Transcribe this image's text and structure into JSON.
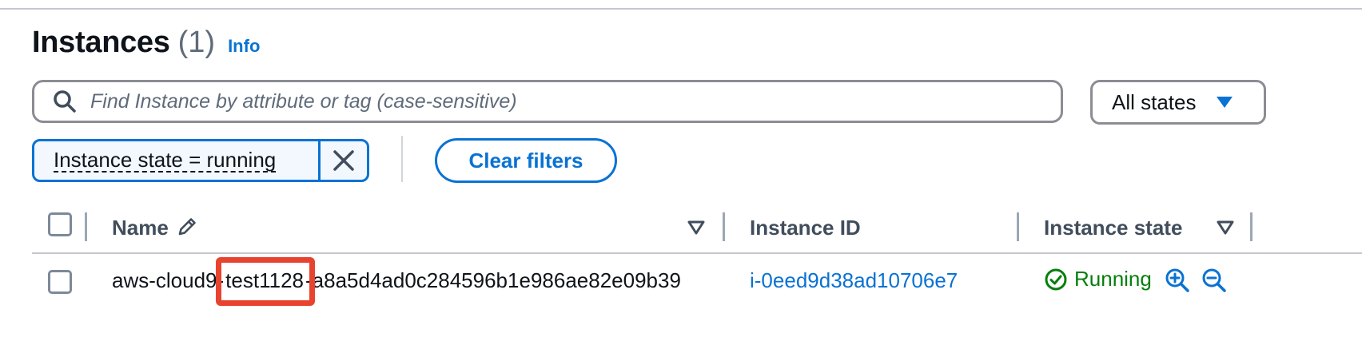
{
  "header": {
    "title": "Instances",
    "count": "(1)",
    "info": "Info"
  },
  "search": {
    "placeholder": "Find Instance by attribute or tag (case-sensitive)",
    "value": ""
  },
  "state_filter": {
    "selected": "All states"
  },
  "filter_token": {
    "label": "Instance state = running"
  },
  "clear_filters": "Clear filters",
  "table": {
    "columns": [
      "Name",
      "Instance ID",
      "Instance state"
    ],
    "rows": [
      {
        "name_prefix": "aws-cloud9-",
        "name_highlight": "test1128",
        "name_suffix": "-a8a5d4ad0c284596b1e986ae82e09b39",
        "instance_id": "i-0eed9d38ad10706e7",
        "state": "Running"
      }
    ]
  },
  "colors": {
    "link": "#0972d3",
    "running": "#037f0c",
    "highlight": "#e8432f"
  },
  "icons": [
    "search-icon",
    "caret-down-icon",
    "close-icon",
    "pencil-icon",
    "sort-icon",
    "check-circle-icon",
    "zoom-in-icon",
    "zoom-out-icon"
  ]
}
